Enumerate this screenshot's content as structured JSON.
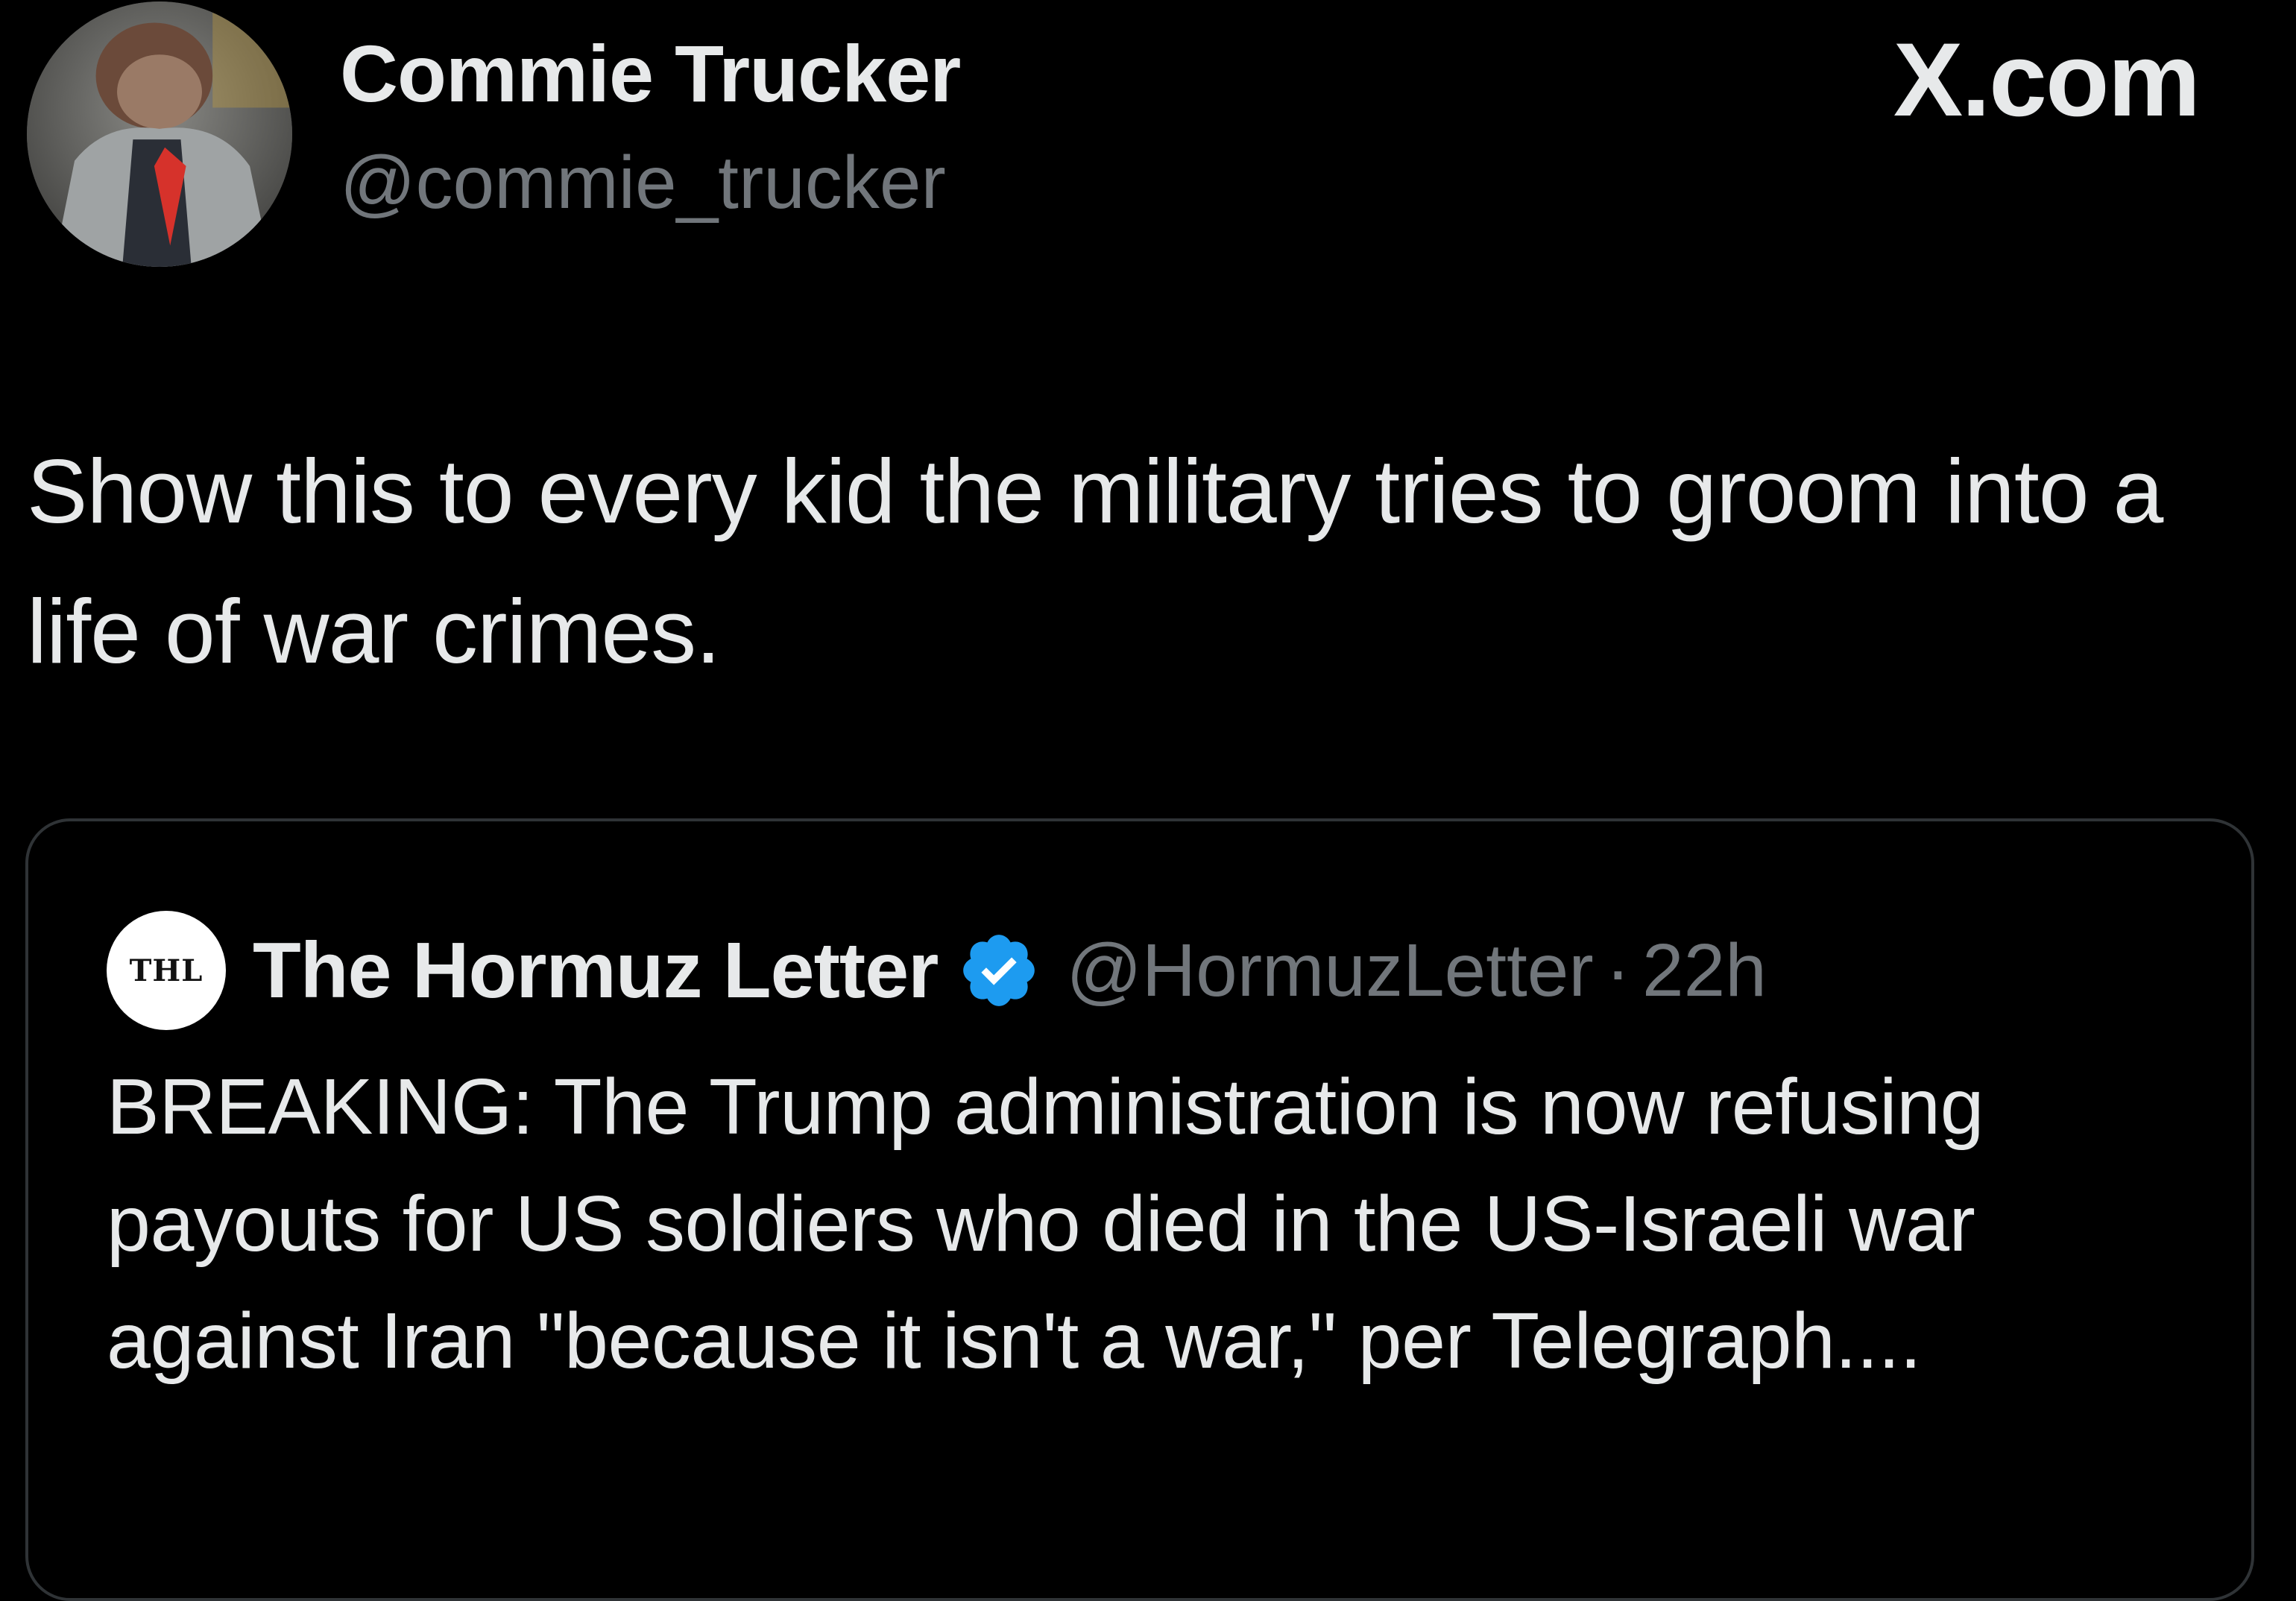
{
  "author": {
    "display_name": "Commie Trucker",
    "handle": "@commie_trucker",
    "avatar_icon": "profile-photo"
  },
  "site_label": "X.com",
  "post": {
    "text": "Show this to every kid the military tries to groom into a life of war crimes."
  },
  "quoted_post": {
    "avatar_text": "THL",
    "display_name": "The Hormuz Letter",
    "verified": true,
    "verified_color": "#1d9bf0",
    "handle": "@HormuzLetter",
    "separator": "·",
    "time": "22h",
    "text": "BREAKING: The Trump administration is now refusing payouts for US soldiers who died in the US-Israeli war against Iran \"because it isn't a war,\" per Telegraph...."
  },
  "colors": {
    "background": "#000000",
    "primary_text": "#e7e9ea",
    "secondary_text": "#71767b",
    "border": "#2f3336"
  }
}
